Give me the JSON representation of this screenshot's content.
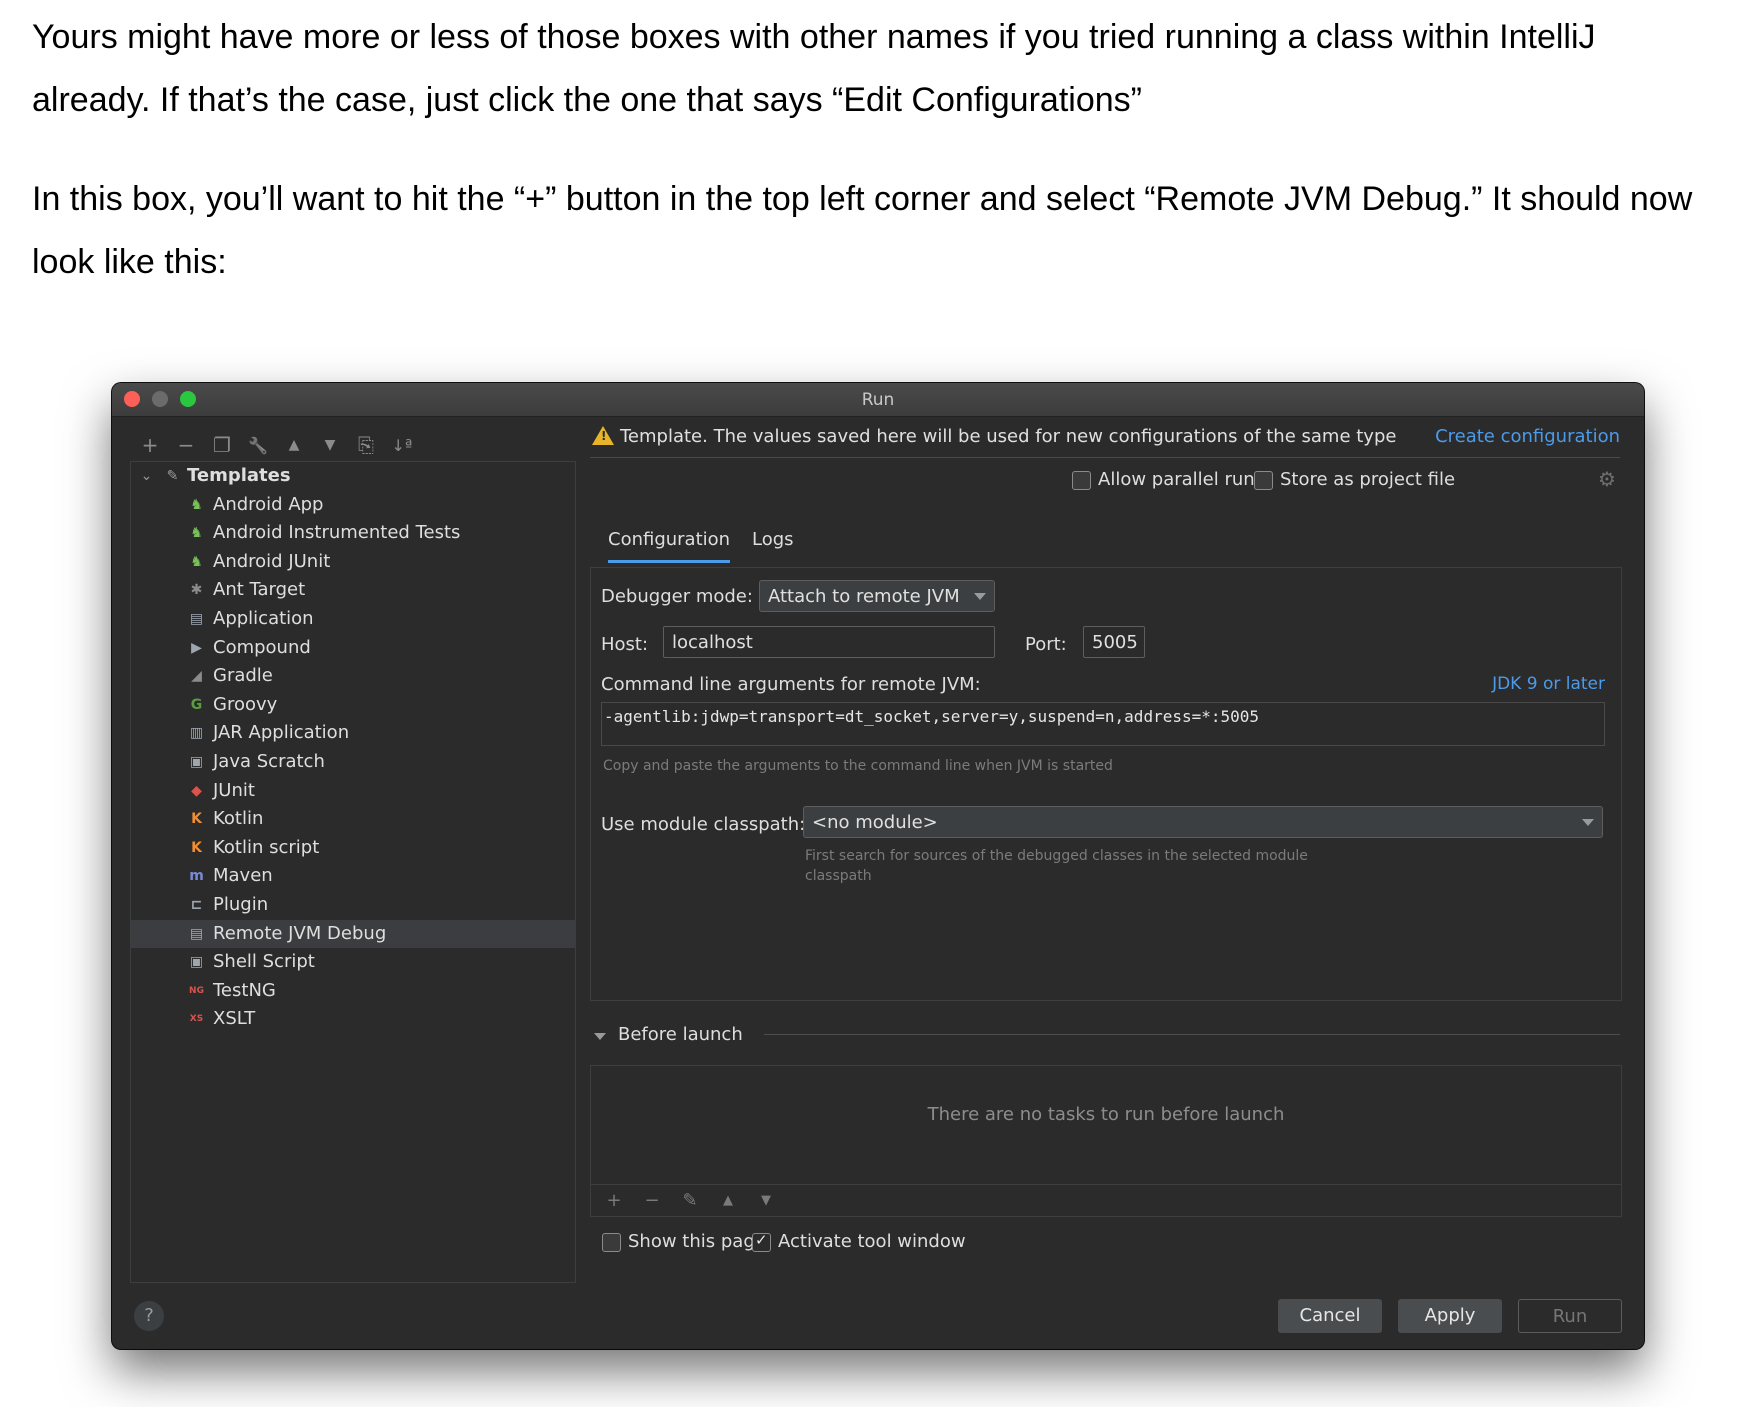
{
  "doc": {
    "paragraph1": "Yours might have more or less of those boxes with other names if you tried running a class within IntelliJ already. If that’s the case, just click the one that says “Edit Configurations”",
    "paragraph2": "In this box, you’ll want to hit the “+” button in the top left corner and select “Remote JVM Debug.” It should now look like this:"
  },
  "window": {
    "title": "Run"
  },
  "toolbar": {
    "add": "+",
    "remove": "−",
    "copy": "❐",
    "wrench": "🔧",
    "up": "▲",
    "down": "▼",
    "folder": "⎘",
    "sort": "↓ª"
  },
  "tree": {
    "root_label": "Templates",
    "items": [
      {
        "label": "Android App",
        "icon": "android-icon",
        "color": "#78c257",
        "glyph": "♞"
      },
      {
        "label": "Android Instrumented Tests",
        "icon": "android-test-icon",
        "color": "#78c257",
        "glyph": "♞"
      },
      {
        "label": "Android JUnit",
        "icon": "android-junit-icon",
        "color": "#78c257",
        "glyph": "♞"
      },
      {
        "label": "Ant Target",
        "icon": "ant-icon",
        "color": "#8c8c8c",
        "glyph": "✱"
      },
      {
        "label": "Application",
        "icon": "application-icon",
        "color": "#9ea7b0",
        "glyph": "▤"
      },
      {
        "label": "Compound",
        "icon": "compound-icon",
        "color": "#9ea7b0",
        "glyph": "▶"
      },
      {
        "label": "Gradle",
        "icon": "gradle-icon",
        "color": "#8c8c8c",
        "glyph": "◢"
      },
      {
        "label": "Groovy",
        "icon": "groovy-icon",
        "color": "#5a9e3f",
        "glyph": "G"
      },
      {
        "label": "JAR Application",
        "icon": "jar-icon",
        "color": "#9ea7b0",
        "glyph": "▥"
      },
      {
        "label": "Java Scratch",
        "icon": "java-scratch-icon",
        "color": "#9ea7b0",
        "glyph": "▣"
      },
      {
        "label": "JUnit",
        "icon": "junit-icon",
        "color": "#d9534f",
        "glyph": "◆"
      },
      {
        "label": "Kotlin",
        "icon": "kotlin-icon",
        "color": "#f18e33",
        "glyph": "K"
      },
      {
        "label": "Kotlin script",
        "icon": "kotlin-script-icon",
        "color": "#f18e33",
        "glyph": "K"
      },
      {
        "label": "Maven",
        "icon": "maven-icon",
        "color": "#7b8ad6",
        "glyph": "m"
      },
      {
        "label": "Plugin",
        "icon": "plugin-icon",
        "color": "#9ea7b0",
        "glyph": "⊏"
      },
      {
        "label": "Remote JVM Debug",
        "icon": "remote-debug-icon",
        "color": "#9ea7b0",
        "glyph": "▤"
      },
      {
        "label": "Shell Script",
        "icon": "shell-icon",
        "color": "#9ea7b0",
        "glyph": "▣"
      },
      {
        "label": "TestNG",
        "icon": "testng-icon",
        "color": "#d9534f",
        "glyph": "NG"
      },
      {
        "label": "XSLT",
        "icon": "xslt-icon",
        "color": "#d9534f",
        "glyph": "XS"
      }
    ],
    "selected": "Remote JVM Debug"
  },
  "warning": {
    "text": "Template. The values saved here will be used for new configurations of the same type",
    "link": "Create configuration"
  },
  "options": {
    "allow_parallel": "Allow parallel run",
    "store_project": "Store as project file"
  },
  "tabs": [
    "Configuration",
    "Logs"
  ],
  "config": {
    "debugger_mode_label": "Debugger mode:",
    "debugger_mode_value": "Attach to remote JVM",
    "host_label": "Host:",
    "host_value": "localhost",
    "port_label": "Port:",
    "port_value": "5005",
    "cmd_label": "Command line arguments for remote JVM:",
    "jdk_option": "JDK 9 or later",
    "cmd_value": "-agentlib:jdwp=transport=dt_socket,server=y,suspend=n,address=*:5005",
    "cmd_hint": "Copy and paste the arguments to the command line when JVM is started",
    "module_label": "Use module classpath:",
    "module_value": "<no module>",
    "module_hint_1": "First search for sources of the debugged classes in the selected module",
    "module_hint_2": "classpath"
  },
  "before_launch": {
    "title": "Before launch",
    "empty": "There are no tasks to run before launch",
    "tools": [
      "+",
      "−",
      "✎",
      "▲",
      "▼"
    ]
  },
  "footer": {
    "show_page": "Show this page",
    "activate_tool": "Activate tool window",
    "help": "?",
    "cancel": "Cancel",
    "apply": "Apply",
    "run": "Run"
  }
}
